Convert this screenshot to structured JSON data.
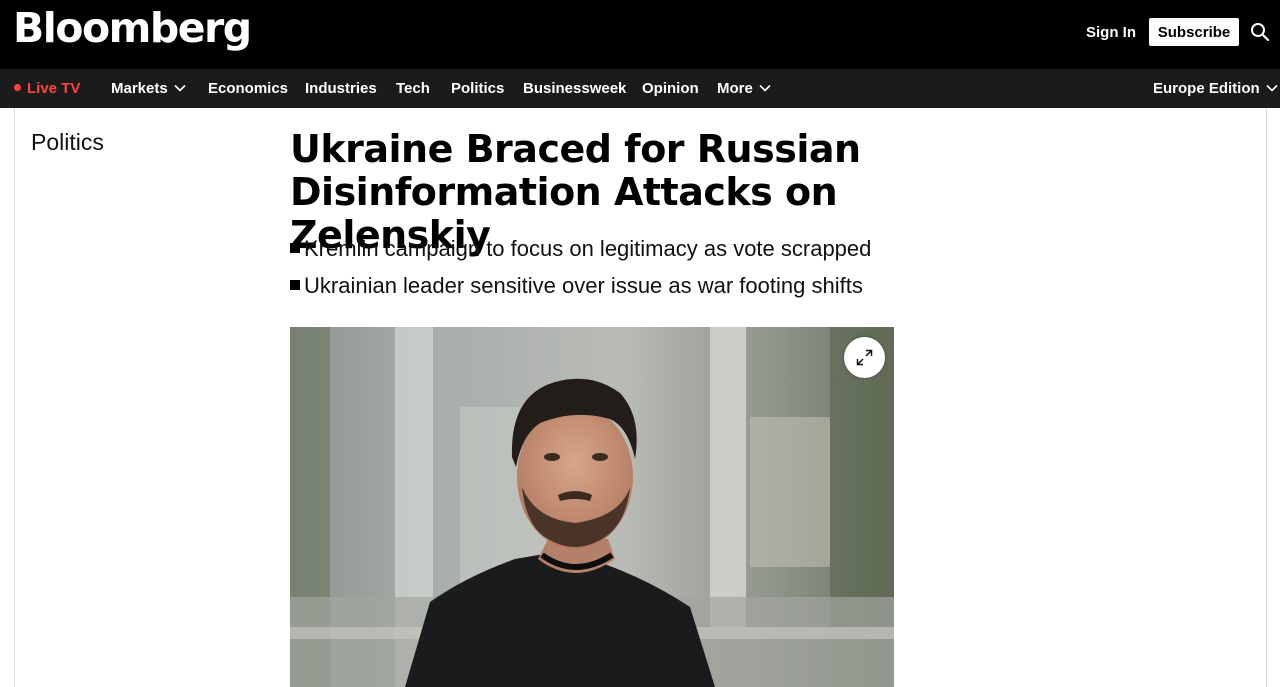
{
  "header": {
    "logo": "Bloomberg",
    "sign_in": "Sign In",
    "subscribe": "Subscribe",
    "search_icon": "search-icon"
  },
  "nav": {
    "live_tv": "Live TV",
    "markets": "Markets",
    "economics": "Economics",
    "industries": "Industries",
    "tech": "Tech",
    "politics": "Politics",
    "businessweek": "Businessweek",
    "opinion": "Opinion",
    "more": "More",
    "edition": "Europe Edition"
  },
  "article": {
    "section": "Politics",
    "headline": "Ukraine Braced for Russian Disinformation Attacks on Zelenskiy",
    "bullets": [
      "Kremlin campaign to focus on legitimacy as vote scrapped",
      "Ukrainian leader sensitive over issue as war footing shifts"
    ],
    "expand_icon": "expand-icon"
  },
  "colors": {
    "topbar": "#000000",
    "navbar": "#1b1b1b",
    "live_accent": "#ff433d",
    "page": "#ffffff"
  }
}
